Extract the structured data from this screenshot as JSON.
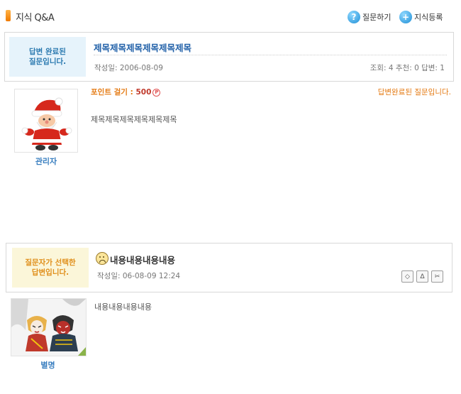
{
  "header": {
    "title": "지식 Q&A",
    "ask_label": "질문하기",
    "register_label": "지식등록"
  },
  "question": {
    "status_line1": "답변 완료된",
    "status_line2": "질문입니다.",
    "title": "제목제목제목제목제목제목",
    "date": "작성일: 2006-08-09",
    "stats": "조회: 4 추천: 0 답변: 1",
    "points_label": "포인트 걸기 : ",
    "points_value": "500",
    "points_unit": "P",
    "answered_tag": "답변완료된 질문입니다.",
    "body": "제목제목제목제목제목제목",
    "author": "관리자"
  },
  "answer": {
    "status_line1": "질문자가 선택한",
    "status_line2": "답변입니다.",
    "title": "내용내용내용내용",
    "date": "작성일: 06-08-09 12:24",
    "body": "내용내용내용내용",
    "author": "별명"
  },
  "icons": {
    "ask": "question-icon",
    "register": "plus-icon",
    "mood": "sad-face-icon"
  },
  "colors": {
    "link_blue": "#2060a8",
    "accent_orange": "#e47911",
    "status_blue_bg": "#e6f3fb",
    "status_yellow_bg": "#fbf6d9"
  }
}
